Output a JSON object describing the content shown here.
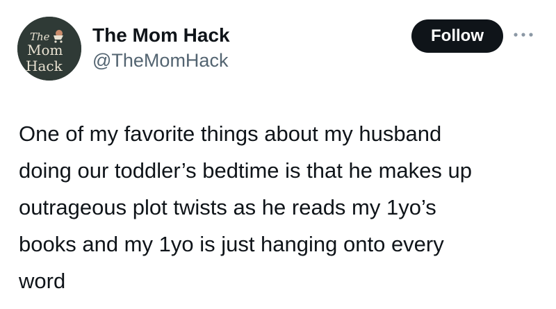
{
  "tweet": {
    "author": {
      "display_name": "The Mom Hack",
      "handle": "@TheMomHack",
      "avatar_logo_text": [
        "The",
        "Mom",
        "Hack"
      ]
    },
    "follow_label": "Follow",
    "more_icon": "more-horizontal-icon",
    "text_lines": [
      "One of my favorite things about my husband",
      "doing our toddler’s bedtime is that he makes up",
      "outrageous plot twists as he reads my 1yo’s",
      "books and my 1yo is just hanging onto every",
      "word"
    ]
  },
  "colors": {
    "avatar_background": "#2f3a36",
    "avatar_logo": "#e9e2d2",
    "avatar_accent": "#c98b6b",
    "follow_button": "#0f1419",
    "follow_text": "#ffffff",
    "handle_text": "#536471",
    "body_text": "#0f1419"
  }
}
